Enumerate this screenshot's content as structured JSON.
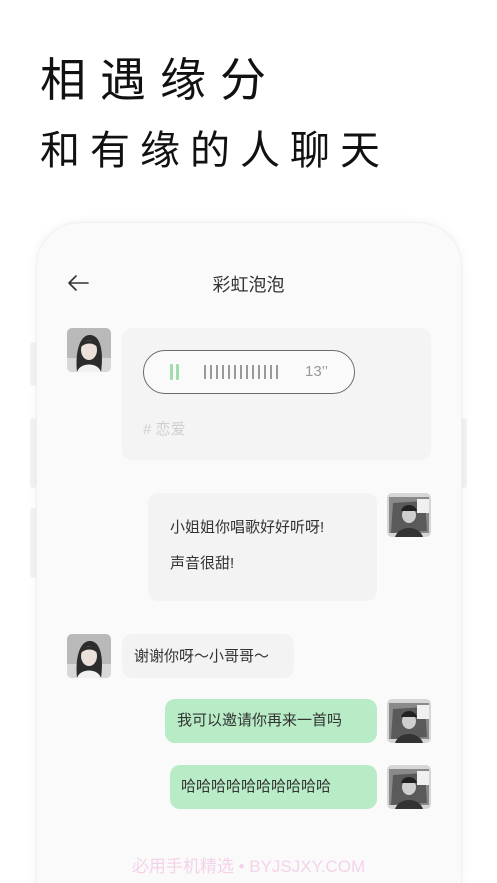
{
  "headline": {
    "line1": "相遇缘分",
    "line2": "和有缘的人聊天"
  },
  "chat": {
    "title": "彩虹泡泡",
    "messages": {
      "voice": {
        "duration": "13’’",
        "tag": "# 恋爱"
      },
      "m1_line1": "小姐姐你唱歌好好听呀!",
      "m1_line2": "声音很甜!",
      "m2": "谢谢你呀～小哥哥～",
      "m3": "我可以邀请你再来一首吗",
      "m4": "哈哈哈哈哈哈哈哈哈哈"
    }
  },
  "watermark": "必用手机精选 • BYJSJXY.COM",
  "icons": [
    "back-arrow-icon",
    "pause-icon",
    "waveform-icon"
  ],
  "colors": {
    "accent_green": "#b8ecc6",
    "pause_green": "#9fdcae",
    "bubble_gray": "#f3f3f3"
  }
}
